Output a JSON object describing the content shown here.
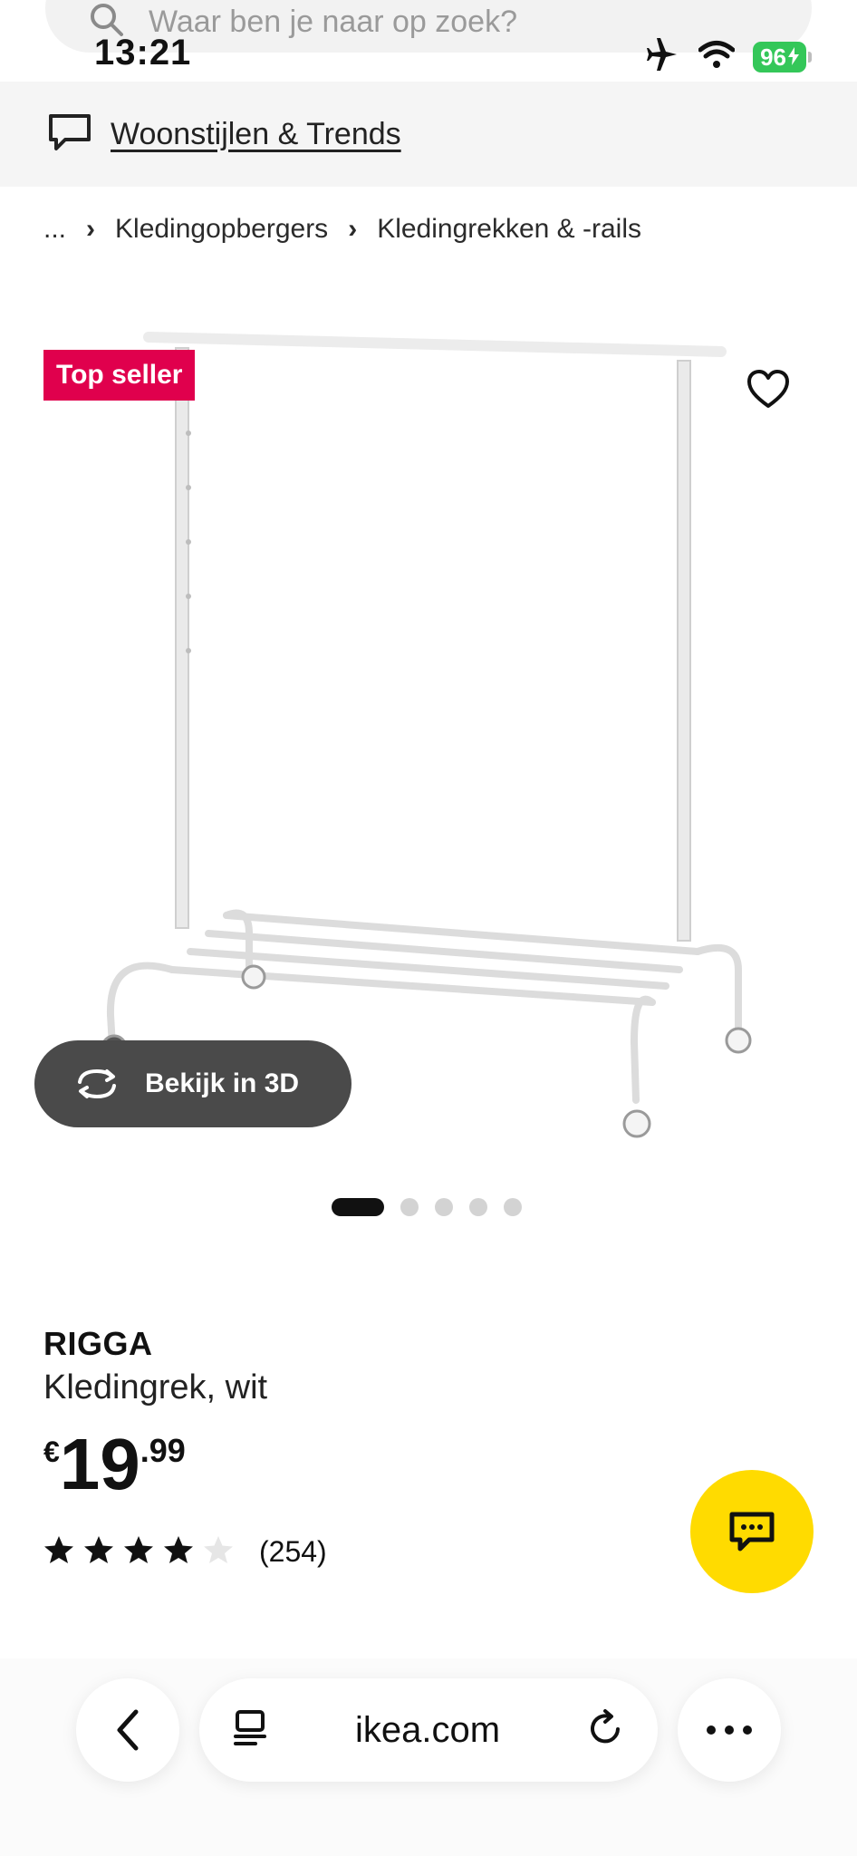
{
  "search": {
    "placeholder": "Waar ben je naar op zoek?"
  },
  "status_bar": {
    "time": "13:21",
    "battery": "96"
  },
  "banner": {
    "link": "Woonstijlen & Trends"
  },
  "breadcrumb": {
    "ellipsis": "...",
    "items": [
      "Kledingopbergers",
      "Kledingrekken & -rails"
    ]
  },
  "product": {
    "badge": "Top seller",
    "view_3d_label": "Bekijk in 3D",
    "carousel_total": 5,
    "carousel_active": 1,
    "name": "RIGGA",
    "description": "Kledingrek, wit",
    "price": {
      "currency": "€",
      "integer": "19",
      "decimal": ".99"
    },
    "rating": {
      "value": 4,
      "max": 5,
      "count": "(254)"
    }
  },
  "browser": {
    "url": "ikea.com"
  },
  "colors": {
    "badge": "#e0004d",
    "chat_fab": "#ffdb00",
    "battery": "#34c759"
  }
}
